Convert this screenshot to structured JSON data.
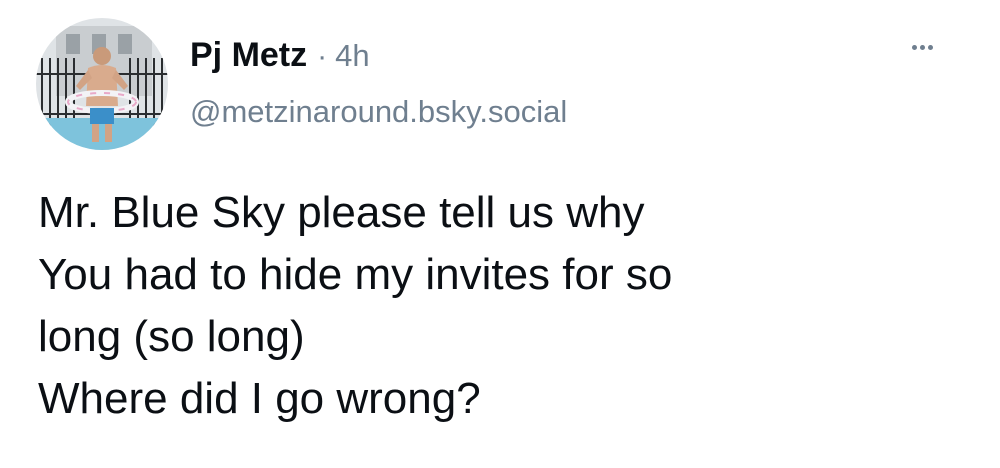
{
  "post": {
    "author": {
      "display_name": "Pj Metz",
      "handle": "@metzinaround.bsky.social",
      "avatar_icon": "avatar-photo-pool-person"
    },
    "separator": "·",
    "time_ago": "4h",
    "more_icon": "more-horizontal-icon",
    "text_lines": [
      "Mr. Blue Sky please tell us why",
      "You had to hide my invites for so",
      "long (so long)",
      "Where did I go wrong?"
    ]
  },
  "colors": {
    "text_primary": "#0b0f14",
    "text_secondary": "#6f7f8f",
    "background": "#ffffff"
  }
}
